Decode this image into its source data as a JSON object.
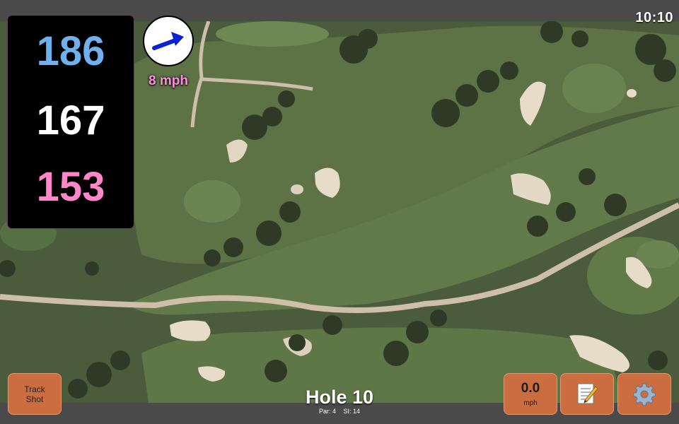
{
  "clock": "10:10",
  "yardage": {
    "back": "186",
    "middle": "167",
    "front": "153"
  },
  "wind": {
    "speed_text": "8 mph"
  },
  "track_button": {
    "line1": "Track",
    "line2": "Shot"
  },
  "speed_button": {
    "value": "0.0",
    "unit": "mph"
  },
  "hole": {
    "title": "Hole 10",
    "par": "Par: 4",
    "si": "SI: 14"
  },
  "icons": {
    "wind_arrow": "arrow-icon",
    "notes": "scorecard-notes-icon",
    "settings": "gear-icon"
  },
  "colors": {
    "back_yardage": "#6fb1ee",
    "middle_yardage": "#ffffff",
    "front_yardage": "#ff86c8",
    "wind_text": "#ff8ee3",
    "button_bg": "#cc6d40",
    "wind_arrow": "#0a21d8"
  }
}
